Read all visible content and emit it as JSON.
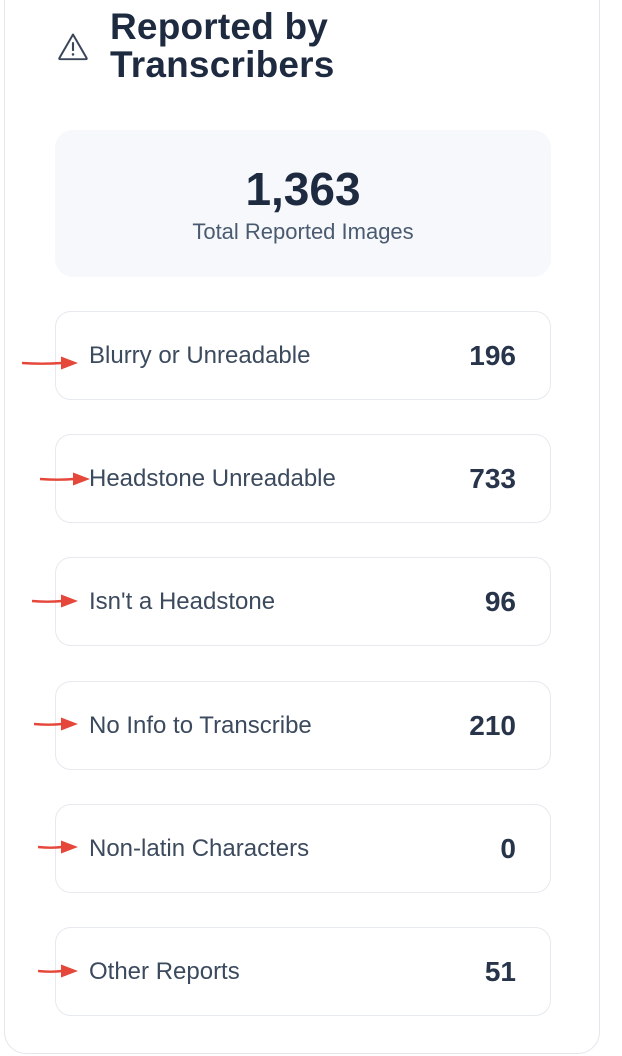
{
  "header": {
    "icon": "warning-triangle-icon",
    "title": "Reported by Transcribers"
  },
  "total": {
    "value": "1,363",
    "label": "Total Reported Images"
  },
  "colors": {
    "arrow": "#e5473a",
    "card_bg": "#f6f8fb",
    "border": "#e6e9ee",
    "title": "#1d2a3f"
  },
  "reports": [
    {
      "label": "Blurry or Unreadable",
      "count": "196"
    },
    {
      "label": "Headstone Unreadable",
      "count": "733"
    },
    {
      "label": "Isn't a Headstone",
      "count": "96"
    },
    {
      "label": "No Info to Transcribe",
      "count": "210"
    },
    {
      "label": "Non-latin Characters",
      "count": "0"
    },
    {
      "label": "Other Reports",
      "count": "51"
    }
  ]
}
